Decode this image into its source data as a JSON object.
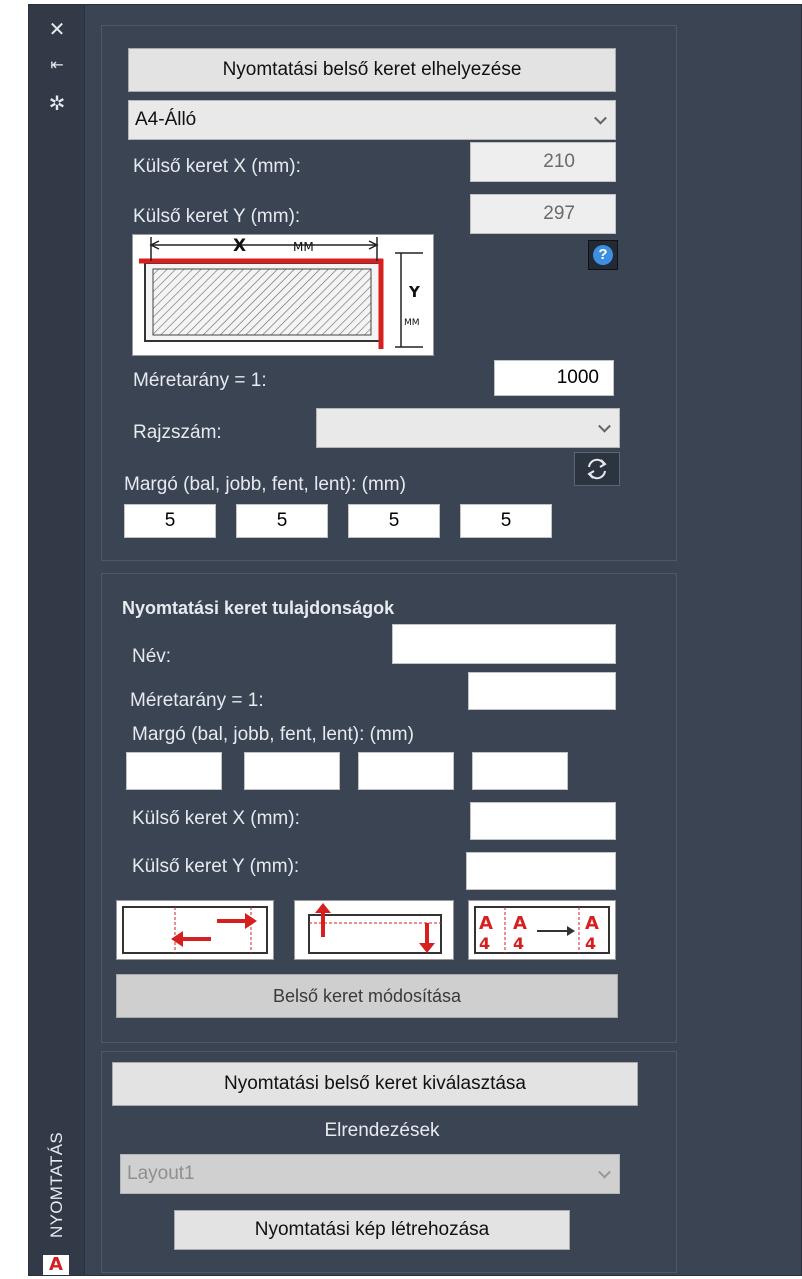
{
  "titlebar": {
    "icons": [
      "close-icon",
      "auto-hide-icon",
      "properties-icon"
    ],
    "close_glyph": "✕",
    "autohide_glyph": "⇤",
    "properties_glyph": "✲",
    "vertical_title": "NYOMTATÁS",
    "app_logo_glyph": "A"
  },
  "inner_frame": {
    "place_button": "Nyomtatási belső keret elhelyezése",
    "paper_format": "A4-Álló",
    "outer_x_label": "Külső keret X (mm):",
    "outer_x_value": "210",
    "outer_y_label": "Külső keret Y (mm):",
    "outer_y_value": "297",
    "diagram_x": "X",
    "diagram_mm": "MM",
    "diagram_y": "Y",
    "diagram_mm_v": "MM",
    "help_glyph": "?",
    "scale_label": "Méretarány = 1:",
    "scale_value": "1000",
    "drawing_number_label": "Rajzszám:",
    "drawing_number_value": "",
    "margin_label": "Margó (bal, jobb, fent, lent): (mm)",
    "margins": [
      "5",
      "5",
      "5",
      "5"
    ]
  },
  "frame_properties": {
    "title": "Nyomtatási keret tulajdonságok",
    "name_label": "Név:",
    "scale_label": "Méretarány = 1:",
    "margin_label": "Margó (bal, jobb, fent, lent): (mm)",
    "outer_x_label": "Külső keret X (mm):",
    "outer_y_label": "Külső keret Y (mm):",
    "tool3_letter": "A",
    "tool3_digit": "4",
    "modify_button": "Belső keret módosítása"
  },
  "layouts": {
    "select_button": "Nyomtatási belső keret kiválasztása",
    "layouts_label": "Elrendezések",
    "layout_value": "Layout1",
    "create_button": "Nyomtatási kép létrehozása"
  },
  "colors": {
    "panel_bg": "#3b4453",
    "accent_red": "#d62020",
    "help_blue": "#3d8fe0"
  }
}
